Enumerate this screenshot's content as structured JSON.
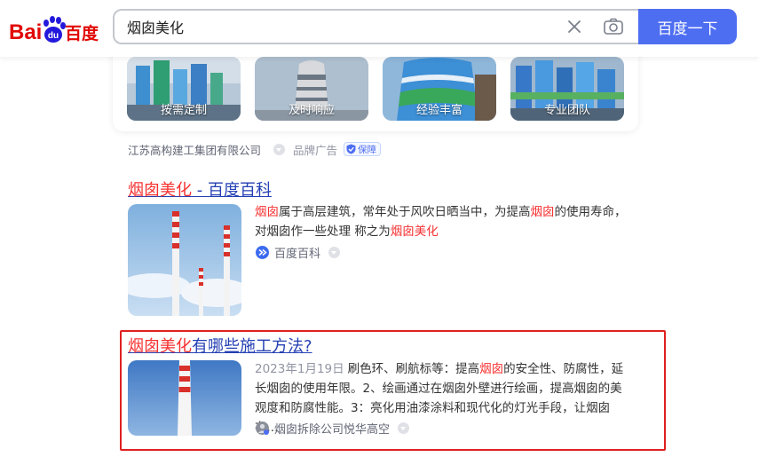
{
  "header": {
    "logo_text_left": "Bai",
    "logo_text_paw": "du",
    "logo_text_right": "百度",
    "search_value": "烟囱美化",
    "search_button_label": "百度一下"
  },
  "ad": {
    "thumbnails": [
      {
        "caption": "按需定制"
      },
      {
        "caption": "及时响应"
      },
      {
        "caption": "经验丰富"
      },
      {
        "caption": "专业团队"
      }
    ],
    "company": "江苏高构建工集团有限公司",
    "brand_label": "品牌广告",
    "guarantee_label": "保障"
  },
  "results": [
    {
      "title_highlight": "烟囱美化",
      "title_rest": " - 百度百科",
      "abstract_parts": [
        {
          "text": "烟囱",
          "hl": true
        },
        {
          "text": "属于高层建筑，常年处于风吹日晒当中，为提高",
          "hl": false
        },
        {
          "text": "烟囱",
          "hl": true
        },
        {
          "text": "的使用寿命，对烟囱作一些处理 称之为",
          "hl": false
        },
        {
          "text": "烟囱美化",
          "hl": true
        }
      ],
      "source": "百度百科"
    },
    {
      "title_highlight": "烟囱美化",
      "title_rest": "有哪些施工方法?",
      "date": "2023年1月19日",
      "abstract_parts": [
        {
          "text": "刷色环、刷航标等：提高",
          "hl": false
        },
        {
          "text": "烟囱",
          "hl": true
        },
        {
          "text": "的安全性、防腐性，延长烟囱的使用年限。2、绘画通过在烟囱外壁进行绘画，提高烟囱的美观度和防腐性能。3：亮化用油漆涂料和现代化的灯光手段，让烟囱在...",
          "hl": false
        }
      ],
      "source": "烟囱拆除公司悦华高空"
    }
  ],
  "colors": {
    "accent": "#4e6ef2",
    "link": "#2440b3",
    "highlight": "#f73131",
    "logo_red": "#e10602",
    "logo_blue": "#2319dc",
    "annotation_box": "#e02020"
  },
  "icons": {
    "clear": "close-icon",
    "camera": "camera-icon",
    "baike": "baike-logo-icon",
    "avatar": "author-avatar-icon",
    "shield": "shield-icon",
    "dropdown": "chevron-down-icon"
  }
}
